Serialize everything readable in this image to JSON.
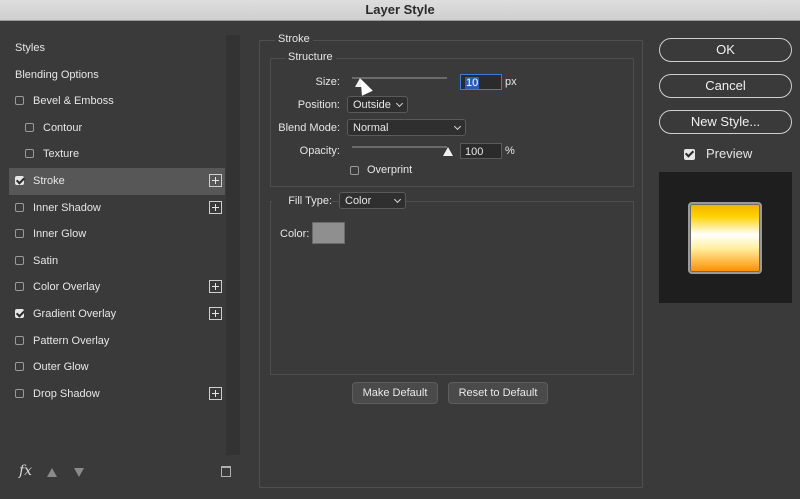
{
  "window": {
    "title": "Layer Style"
  },
  "styles_panel": {
    "items": [
      {
        "label": "Styles",
        "type": "header"
      },
      {
        "label": "Blending Options",
        "type": "header"
      },
      {
        "label": "Bevel & Emboss",
        "checked": false
      },
      {
        "label": "Contour",
        "checked": false
      },
      {
        "label": "Texture",
        "checked": false
      },
      {
        "label": "Stroke",
        "checked": true
      },
      {
        "label": "Inner Shadow",
        "checked": false
      },
      {
        "label": "Inner Glow",
        "checked": false
      },
      {
        "label": "Satin",
        "checked": false
      },
      {
        "label": "Color Overlay",
        "checked": false
      },
      {
        "label": "Gradient Overlay",
        "checked": true
      },
      {
        "label": "Pattern Overlay",
        "checked": false
      },
      {
        "label": "Outer Glow",
        "checked": false
      },
      {
        "label": "Drop Shadow",
        "checked": false
      }
    ],
    "fx_label": "fx"
  },
  "stroke": {
    "title": "Stroke",
    "structure": {
      "title": "Structure",
      "size_label": "Size:",
      "size_value": "10",
      "size_unit": "px",
      "position_label": "Position:",
      "position_value": "Outside",
      "blend_mode_label": "Blend Mode:",
      "blend_mode_value": "Normal",
      "opacity_label": "Opacity:",
      "opacity_value": "100",
      "opacity_unit": "%",
      "overprint_label": "Overprint",
      "overprint_checked": false
    },
    "fill": {
      "type_label": "Fill Type:",
      "type_value": "Color",
      "color_label": "Color:",
      "color_hex": "#8f8f8f"
    },
    "make_default_label": "Make Default",
    "reset_default_label": "Reset to Default"
  },
  "actions": {
    "ok_label": "OK",
    "cancel_label": "Cancel",
    "new_style_label": "New Style...",
    "preview_label": "Preview",
    "preview_checked": true
  },
  "colors": {
    "selection_blue": "#2b5fb3",
    "dialog_bg": "#3a3a3a"
  }
}
